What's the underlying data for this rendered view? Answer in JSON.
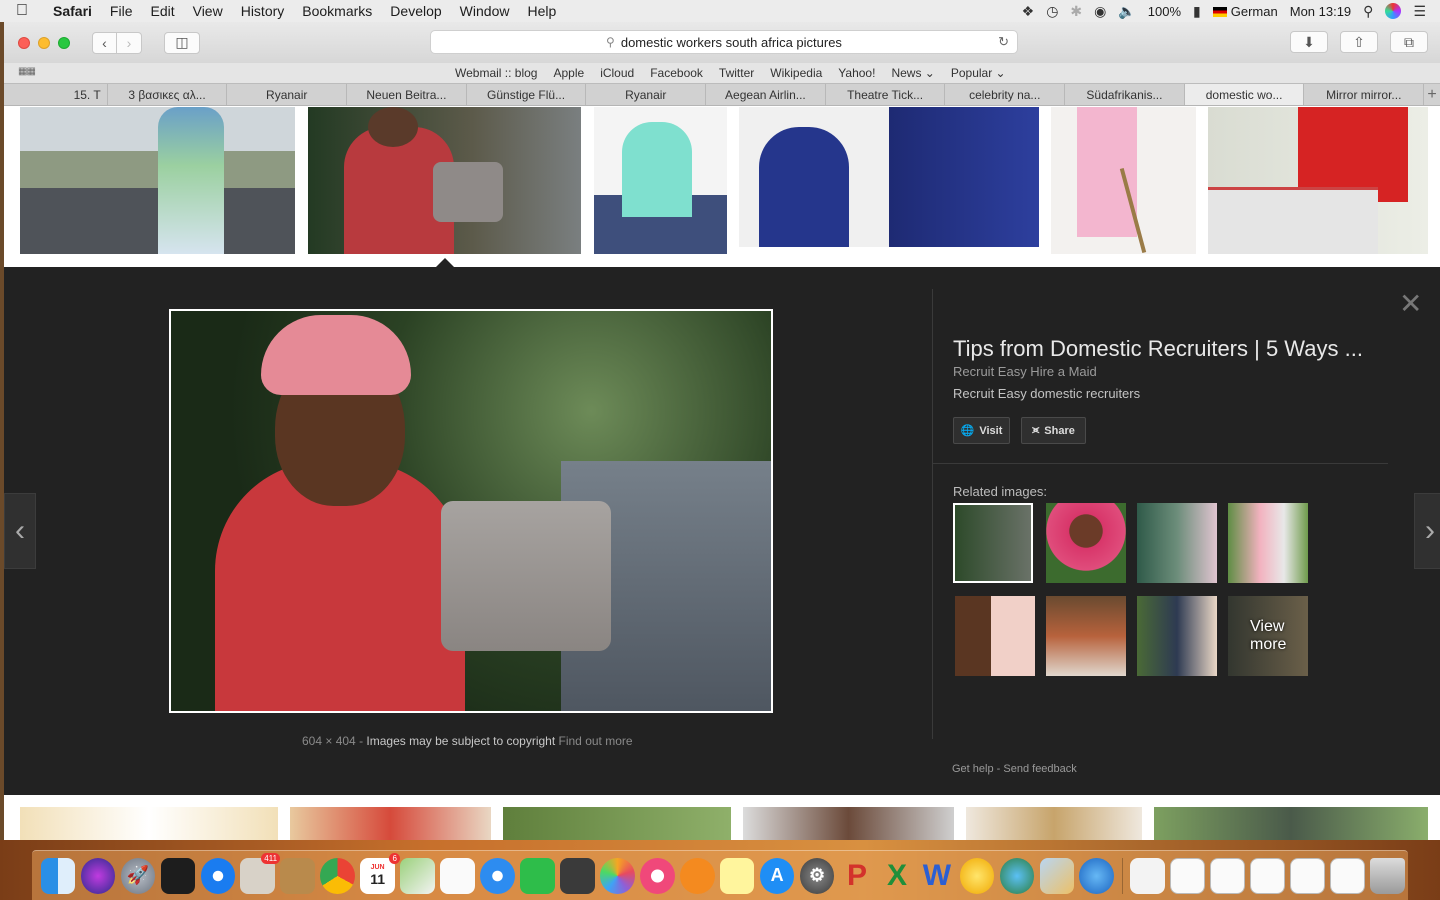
{
  "menubar": {
    "app_name": "Safari",
    "items": [
      "File",
      "Edit",
      "View",
      "History",
      "Bookmarks",
      "Develop",
      "Window",
      "Help"
    ],
    "battery": "100%",
    "input_language": "German",
    "clock": "Mon 13:19"
  },
  "browser": {
    "url_text": "domestic workers south africa pictures",
    "favorites": [
      "Webmail :: blog",
      "Apple",
      "iCloud",
      "Facebook",
      "Twitter",
      "Wikipedia",
      "Yahoo!",
      "News ⌄",
      "Popular ⌄"
    ],
    "tabs": [
      {
        "label": "15. T",
        "active": false
      },
      {
        "label": "3 βασικες αλ...",
        "active": false
      },
      {
        "label": "Ryanair",
        "active": false
      },
      {
        "label": "Neuen Beitra...",
        "active": false
      },
      {
        "label": "Günstige Flü...",
        "active": false
      },
      {
        "label": "Ryanair",
        "active": false
      },
      {
        "label": "Aegean Airlin...",
        "active": false
      },
      {
        "label": "Theatre Tick...",
        "active": false
      },
      {
        "label": "celebrity na...",
        "active": false
      },
      {
        "label": "Südafrikanis...",
        "active": false
      },
      {
        "label": "domestic wo...",
        "active": true
      },
      {
        "label": "Mirror mirror...",
        "active": false
      }
    ]
  },
  "preview": {
    "image_size": "604 × 404",
    "separator": "-",
    "copyright_note": "Images may be subject to copyright",
    "find_out_more": "Find out more",
    "title": "Tips from Domestic Recruiters | 5 Ways ...",
    "site": "Recruit Easy Hire a Maid",
    "description": "Recruit Easy domestic recruiters",
    "visit_label": "Visit",
    "share_label": "Share",
    "related_label": "Related images:",
    "view_more_line1": "View",
    "view_more_line2": "more",
    "get_help": "Get help",
    "send_feedback": "Send feedback"
  },
  "dock": {
    "mail_badge": "411",
    "calendar_month": "JUN",
    "calendar_day": "11",
    "calendar_badge": "6"
  },
  "colors": {
    "panel_bg": "#222222",
    "accent_red": "#c8383c"
  }
}
